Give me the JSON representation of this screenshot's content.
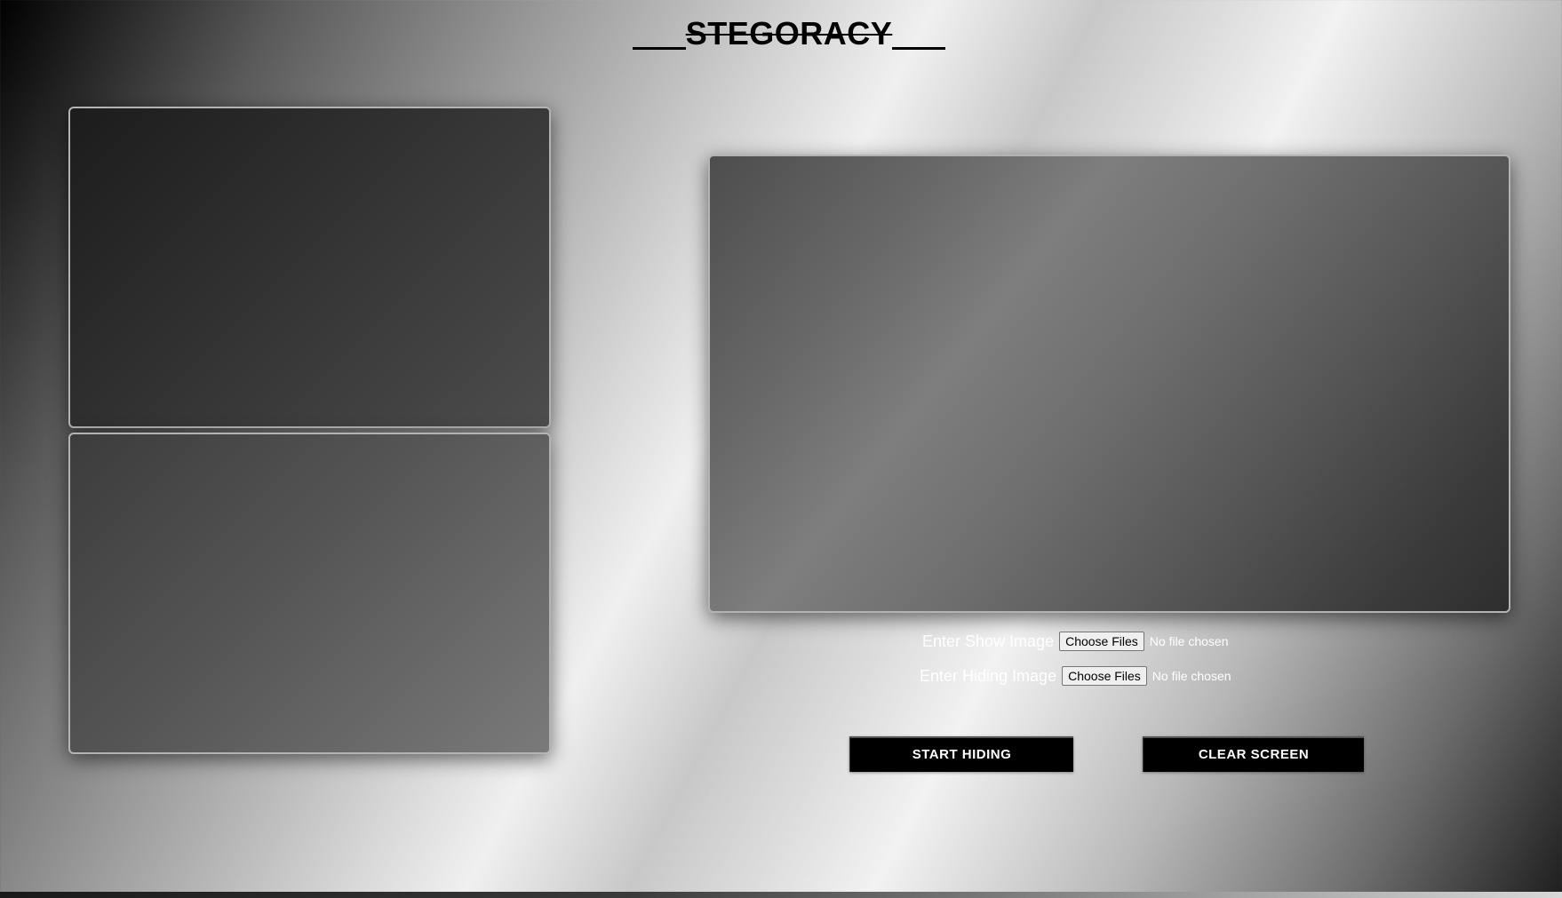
{
  "header": {
    "title": "STEGORACY"
  },
  "form": {
    "show_image": {
      "label": "Enter Show Image",
      "button_label": "Choose Files",
      "status": "No file chosen"
    },
    "hiding_image": {
      "label": "Enter Hiding Image",
      "button_label": "Choose Files",
      "status": "No file chosen"
    }
  },
  "actions": {
    "start_label": "START HIDING",
    "clear_label": "CLEAR SCREEN"
  },
  "colors": {
    "button_bg": "#000000",
    "button_text": "#ffffff",
    "panel_border": "#b3b3b3"
  }
}
